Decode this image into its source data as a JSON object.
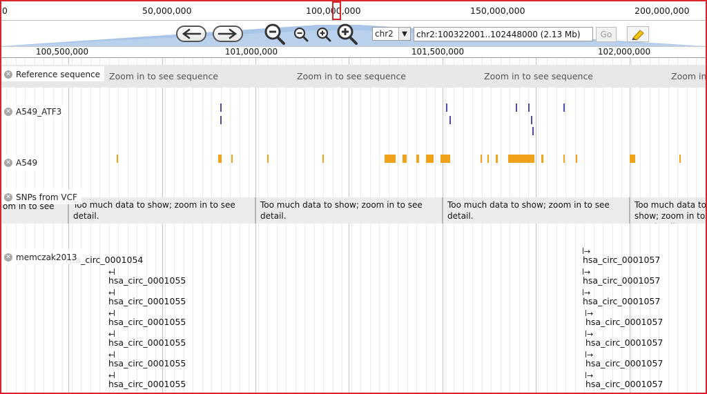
{
  "overview": {
    "labels": [
      "0",
      "50,000,000",
      "100,000,000",
      "150,000,000",
      "200,000,000"
    ]
  },
  "navbar": {
    "chromosome": "chr2",
    "location": "chr2:100322001..102448000 (2.13 Mb)",
    "go_label": "Go"
  },
  "ruler": {
    "labels": [
      "100,500,000",
      "101,000,000",
      "101,500,000",
      "102,000,000"
    ]
  },
  "reference_sequence": {
    "label": "Reference sequence",
    "message": "Zoom in to see sequence"
  },
  "tracks": [
    {
      "name": "A549_ATF3"
    },
    {
      "name": "A549"
    },
    {
      "name": "SNPs from VCF"
    },
    {
      "name": "memczak2013"
    }
  ],
  "snp_message": "Too much data to show; zoom in to see detail.",
  "snp_message_partial": "om in to see",
  "circ_features": {
    "left": [
      "hsa_circ_0001054",
      "hsa_circ_0001055",
      "hsa_circ_0001055",
      "hsa_circ_0001055",
      "hsa_circ_0001055",
      "hsa_circ_0001055",
      "hsa_circ_0001055"
    ],
    "right": [
      "hsa_circ_0001057",
      "hsa_circ_0001057",
      "hsa_circ_0001057",
      "hsa_circ_0001057",
      "hsa_circ_0001057",
      "hsa_circ_0001057",
      "hsa_circ_0001057"
    ]
  },
  "colors": {
    "atf3_feature": "#4a4ab0",
    "a549_feature": "#f0a21a",
    "frame": "#d9252a"
  }
}
